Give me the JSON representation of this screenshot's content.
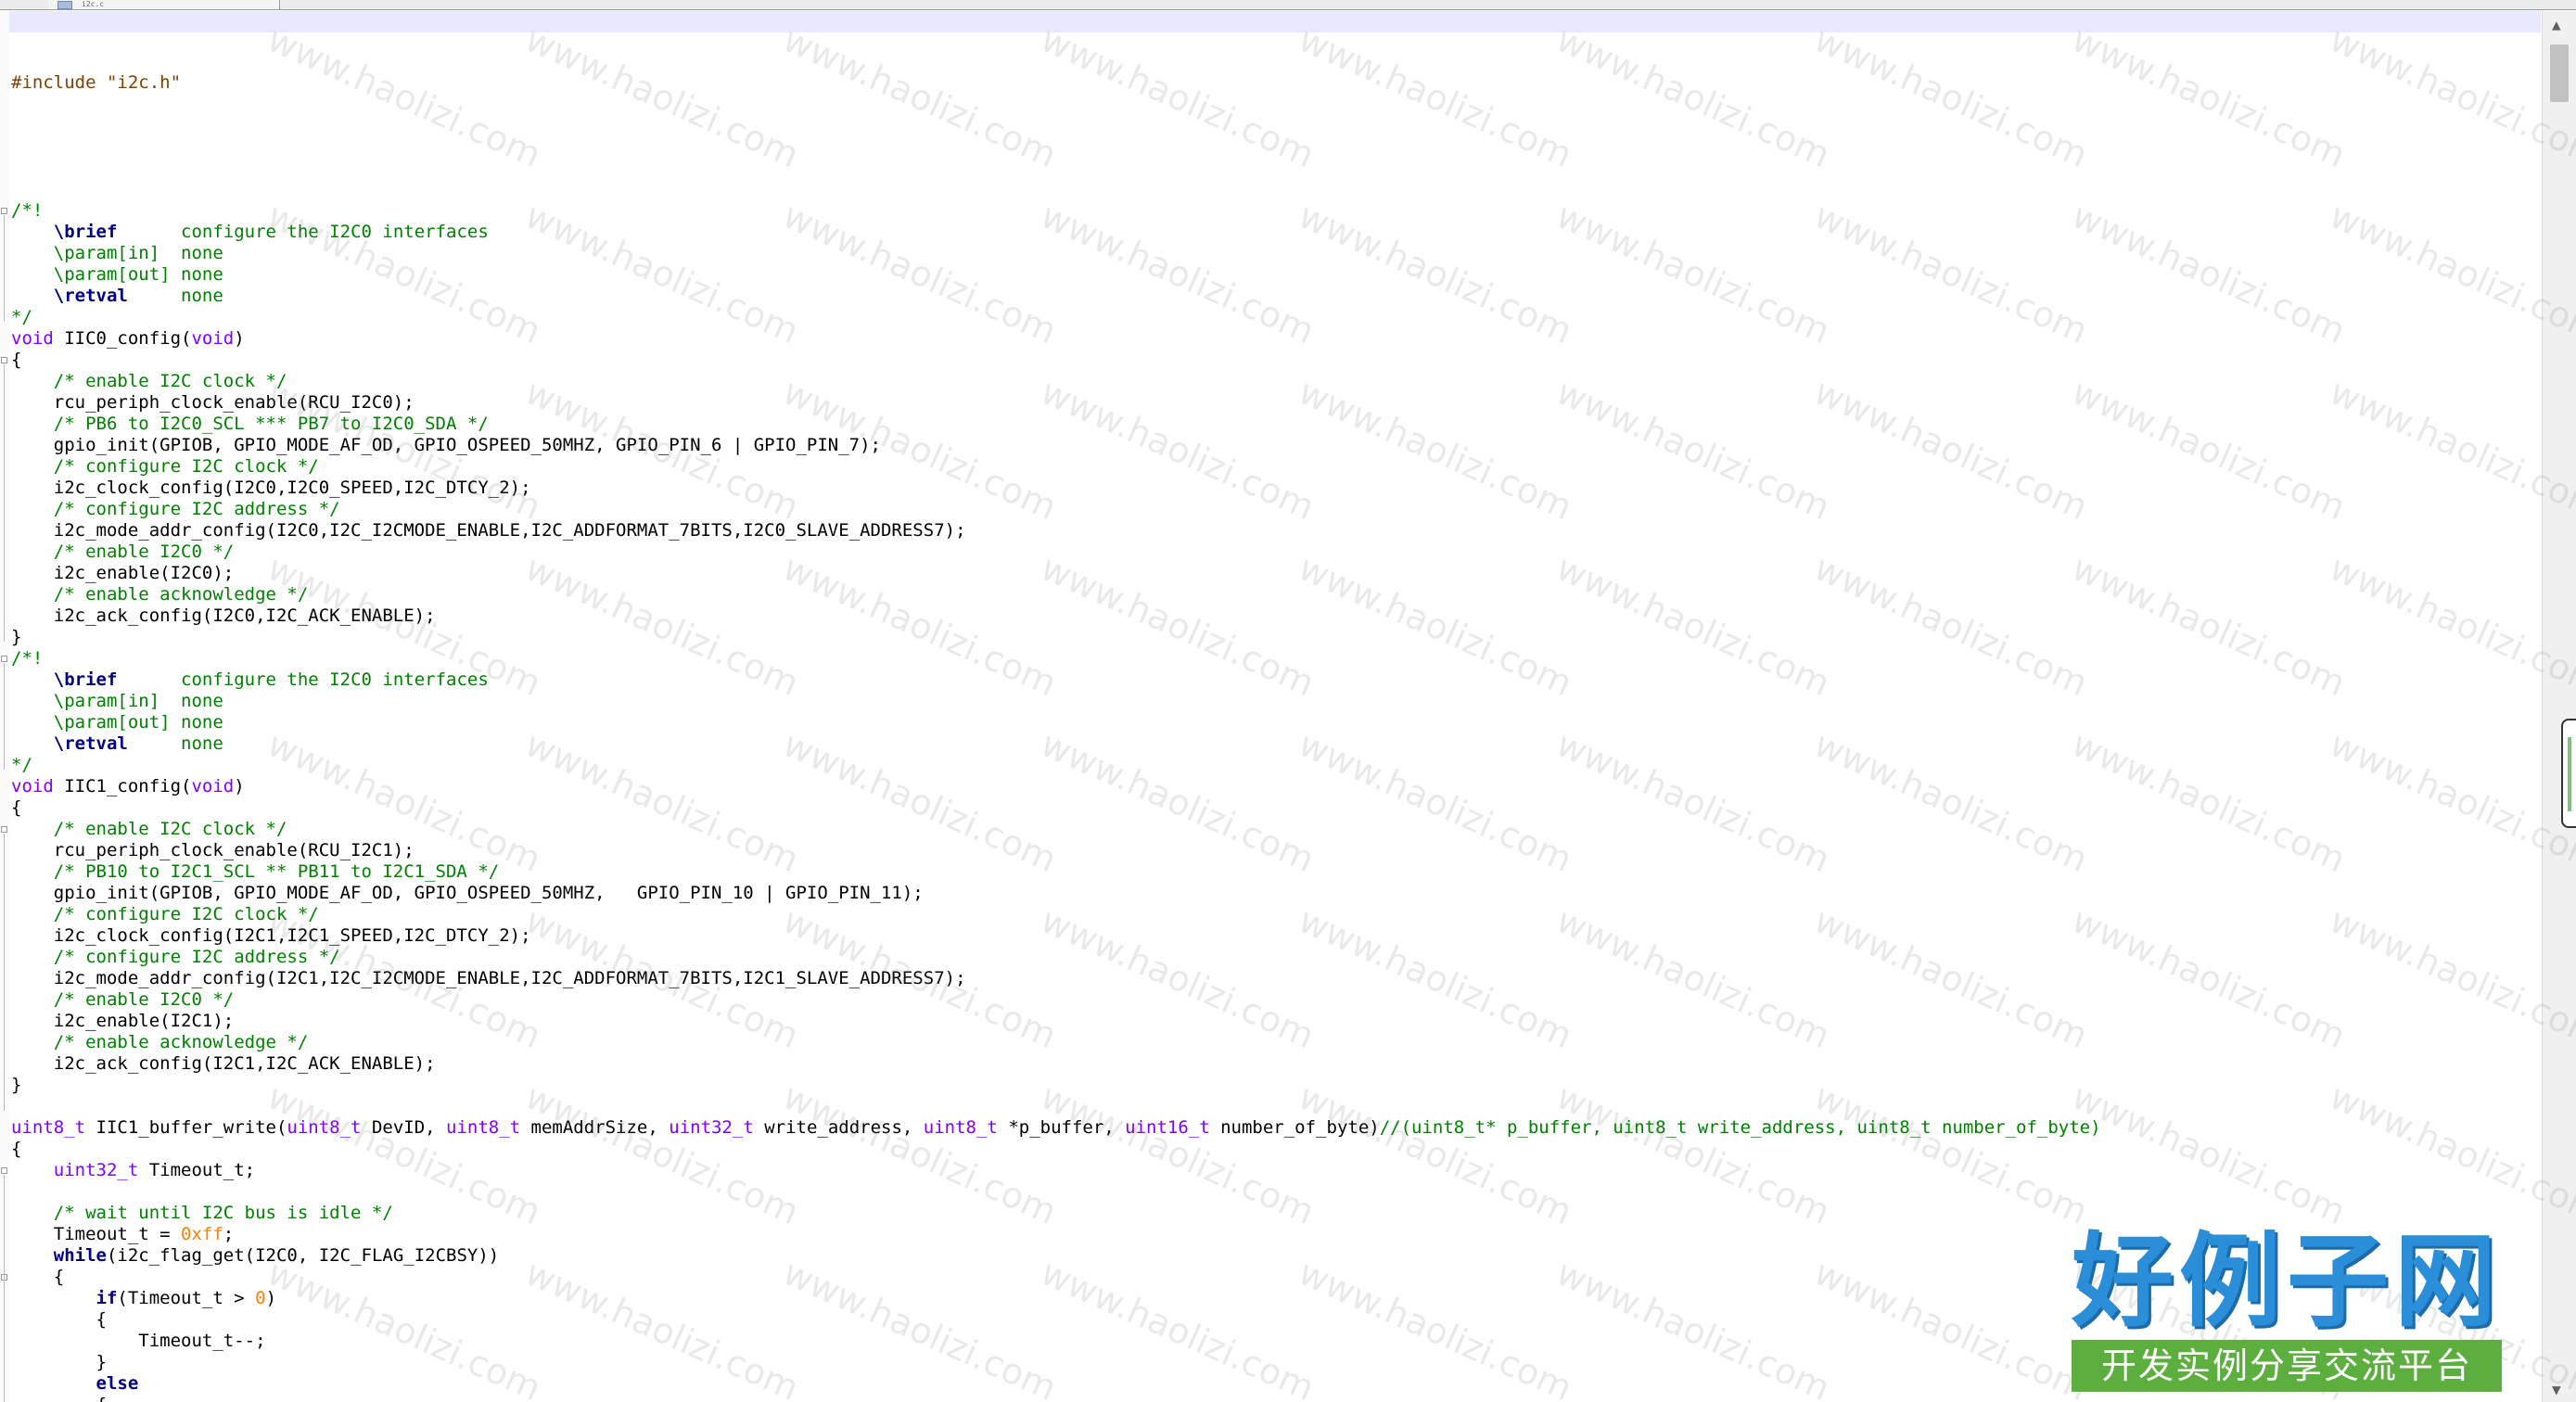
{
  "tab": {
    "label": "i2c.c"
  },
  "editor": {
    "lines": [
      [],
      [
        {
          "c": "pre",
          "t": "#include \"i2c.h\""
        }
      ],
      [],
      [],
      [],
      [],
      [],
      [
        {
          "c": "comment",
          "t": "/*!"
        }
      ],
      [
        {
          "c": "comment",
          "t": "    "
        },
        {
          "c": "kw",
          "t": "\\brief"
        },
        {
          "c": "comment",
          "t": "      configure the I2C0 interfaces"
        }
      ],
      [
        {
          "c": "comment",
          "t": "    \\param[in]  none"
        }
      ],
      [
        {
          "c": "comment",
          "t": "    \\param[out] none"
        }
      ],
      [
        {
          "c": "comment",
          "t": "    "
        },
        {
          "c": "kw",
          "t": "\\retval"
        },
        {
          "c": "comment",
          "t": "     none"
        }
      ],
      [
        {
          "c": "comment",
          "t": "*/"
        }
      ],
      [
        {
          "c": "type",
          "t": "void"
        },
        {
          "c": "plain",
          "t": " IIC0_config("
        },
        {
          "c": "type",
          "t": "void"
        },
        {
          "c": "plain",
          "t": ")"
        }
      ],
      [
        {
          "c": "plain",
          "t": "{"
        }
      ],
      [
        {
          "c": "comment",
          "t": "    /* enable I2C clock */"
        }
      ],
      [
        {
          "c": "plain",
          "t": "    rcu_periph_clock_enable(RCU_I2C0);"
        }
      ],
      [
        {
          "c": "comment",
          "t": "    /* PB6 to I2C0_SCL *** PB7 to I2C0_SDA */"
        }
      ],
      [
        {
          "c": "plain",
          "t": "    gpio_init(GPIOB, GPIO_MODE_AF_OD, GPIO_OSPEED_50MHZ, GPIO_PIN_6 | GPIO_PIN_7);"
        }
      ],
      [
        {
          "c": "comment",
          "t": "    /* configure I2C clock */"
        }
      ],
      [
        {
          "c": "plain",
          "t": "    i2c_clock_config(I2C0,I2C0_SPEED,I2C_DTCY_2);"
        }
      ],
      [
        {
          "c": "comment",
          "t": "    /* configure I2C address */"
        }
      ],
      [
        {
          "c": "plain",
          "t": "    i2c_mode_addr_config(I2C0,I2C_I2CMODE_ENABLE,I2C_ADDFORMAT_7BITS,I2C0_SLAVE_ADDRESS7);"
        }
      ],
      [
        {
          "c": "comment",
          "t": "    /* enable I2C0 */"
        }
      ],
      [
        {
          "c": "plain",
          "t": "    i2c_enable(I2C0);"
        }
      ],
      [
        {
          "c": "comment",
          "t": "    /* enable acknowledge */"
        }
      ],
      [
        {
          "c": "plain",
          "t": "    i2c_ack_config(I2C0,I2C_ACK_ENABLE);"
        }
      ],
      [
        {
          "c": "plain",
          "t": "}"
        }
      ],
      [
        {
          "c": "comment",
          "t": "/*!"
        }
      ],
      [
        {
          "c": "comment",
          "t": "    "
        },
        {
          "c": "kw",
          "t": "\\brief"
        },
        {
          "c": "comment",
          "t": "      configure the I2C0 interfaces"
        }
      ],
      [
        {
          "c": "comment",
          "t": "    \\param[in]  none"
        }
      ],
      [
        {
          "c": "comment",
          "t": "    \\param[out] none"
        }
      ],
      [
        {
          "c": "comment",
          "t": "    "
        },
        {
          "c": "kw",
          "t": "\\retval"
        },
        {
          "c": "comment",
          "t": "     none"
        }
      ],
      [
        {
          "c": "comment",
          "t": "*/"
        }
      ],
      [
        {
          "c": "type",
          "t": "void"
        },
        {
          "c": "plain",
          "t": " IIC1_config("
        },
        {
          "c": "type",
          "t": "void"
        },
        {
          "c": "plain",
          "t": ")"
        }
      ],
      [
        {
          "c": "plain",
          "t": "{"
        }
      ],
      [
        {
          "c": "comment",
          "t": "    /* enable I2C clock */"
        }
      ],
      [
        {
          "c": "plain",
          "t": "    rcu_periph_clock_enable(RCU_I2C1);"
        }
      ],
      [
        {
          "c": "comment",
          "t": "    /* PB10 to I2C1_SCL ** PB11 to I2C1_SDA */"
        }
      ],
      [
        {
          "c": "plain",
          "t": "    gpio_init(GPIOB, GPIO_MODE_AF_OD, GPIO_OSPEED_50MHZ,   GPIO_PIN_10 | GPIO_PIN_11);"
        }
      ],
      [
        {
          "c": "comment",
          "t": "    /* configure I2C clock */"
        }
      ],
      [
        {
          "c": "plain",
          "t": "    i2c_clock_config(I2C1,I2C1_SPEED,I2C_DTCY_2);"
        }
      ],
      [
        {
          "c": "comment",
          "t": "    /* configure I2C address */"
        }
      ],
      [
        {
          "c": "plain",
          "t": "    i2c_mode_addr_config(I2C1,I2C_I2CMODE_ENABLE,I2C_ADDFORMAT_7BITS,I2C1_SLAVE_ADDRESS7);"
        }
      ],
      [
        {
          "c": "comment",
          "t": "    /* enable I2C0 */"
        }
      ],
      [
        {
          "c": "plain",
          "t": "    i2c_enable(I2C1);"
        }
      ],
      [
        {
          "c": "comment",
          "t": "    /* enable acknowledge */"
        }
      ],
      [
        {
          "c": "plain",
          "t": "    i2c_ack_config(I2C1,I2C_ACK_ENABLE);"
        }
      ],
      [
        {
          "c": "plain",
          "t": "}"
        }
      ],
      [],
      [
        {
          "c": "type",
          "t": "uint8_t"
        },
        {
          "c": "plain",
          "t": " IIC1_buffer_write("
        },
        {
          "c": "type",
          "t": "uint8_t"
        },
        {
          "c": "plain",
          "t": " DevID, "
        },
        {
          "c": "type",
          "t": "uint8_t"
        },
        {
          "c": "plain",
          "t": " memAddrSize, "
        },
        {
          "c": "type",
          "t": "uint32_t"
        },
        {
          "c": "plain",
          "t": " write_address, "
        },
        {
          "c": "type",
          "t": "uint8_t"
        },
        {
          "c": "plain",
          "t": " *p_buffer, "
        },
        {
          "c": "type",
          "t": "uint16_t"
        },
        {
          "c": "plain",
          "t": " number_of_byte)"
        },
        {
          "c": "comment",
          "t": "//(uint8_t* p_buffer, uint8_t write_address, uint8_t number_of_byte)"
        }
      ],
      [
        {
          "c": "plain",
          "t": "{"
        }
      ],
      [
        {
          "c": "plain",
          "t": "    "
        },
        {
          "c": "type",
          "t": "uint32_t"
        },
        {
          "c": "plain",
          "t": " Timeout_t;"
        }
      ],
      [],
      [
        {
          "c": "comment",
          "t": "    /* wait until I2C bus is idle */"
        }
      ],
      [
        {
          "c": "plain",
          "t": "    Timeout_t = "
        },
        {
          "c": "num",
          "t": "0xff"
        },
        {
          "c": "plain",
          "t": ";"
        }
      ],
      [
        {
          "c": "plain",
          "t": "    "
        },
        {
          "c": "kw",
          "t": "while"
        },
        {
          "c": "plain",
          "t": "(i2c_flag_get(I2C0, I2C_FLAG_I2CBSY))"
        }
      ],
      [
        {
          "c": "plain",
          "t": "    {"
        }
      ],
      [
        {
          "c": "plain",
          "t": "        "
        },
        {
          "c": "kw",
          "t": "if"
        },
        {
          "c": "plain",
          "t": "(Timeout_t > "
        },
        {
          "c": "num",
          "t": "0"
        },
        {
          "c": "plain",
          "t": ")"
        }
      ],
      [
        {
          "c": "plain",
          "t": "        {"
        }
      ],
      [
        {
          "c": "plain",
          "t": "            Timeout_t--;"
        }
      ],
      [
        {
          "c": "plain",
          "t": "        }"
        }
      ],
      [
        {
          "c": "plain",
          "t": "        "
        },
        {
          "c": "kw",
          "t": "else"
        }
      ],
      [
        {
          "c": "plain",
          "t": "        {"
        }
      ]
    ]
  },
  "watermark": {
    "text": "www.haolizi.com"
  },
  "logo": {
    "main": "好例子网",
    "sub": "开发实例分享交流平台"
  },
  "colors": {
    "keyword": "#000080",
    "type": "#8000ff",
    "comment": "#008000",
    "preprocessor": "#804000",
    "number": "#ff8000",
    "current_line": "#e8e8ff"
  }
}
